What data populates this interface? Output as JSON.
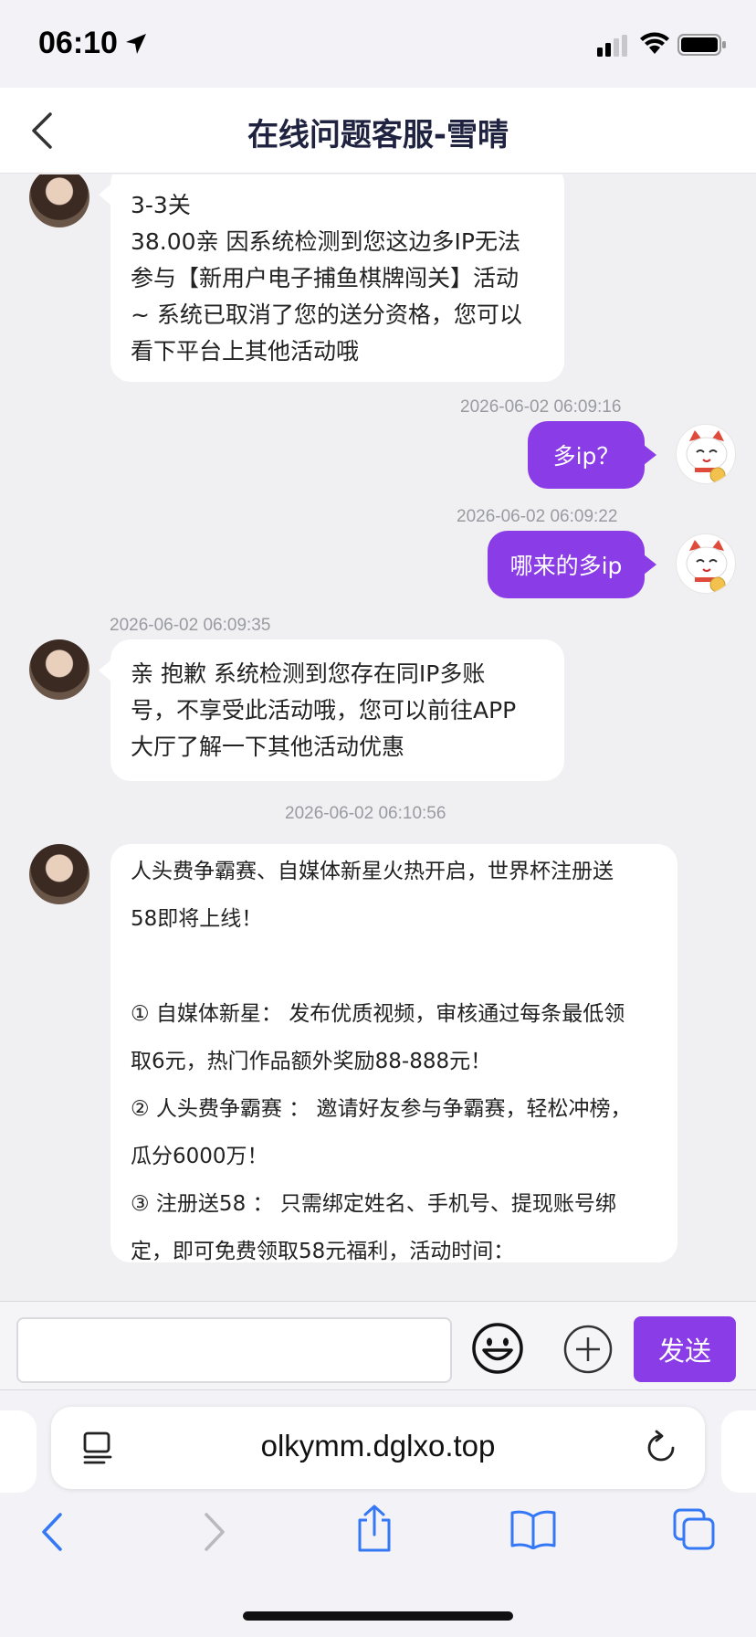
{
  "status_bar": {
    "time": "06:10"
  },
  "header": {
    "title": "在线问题客服-雪晴"
  },
  "messages": {
    "m1": {
      "lines": [
        "3-3关",
        "38.00亲 因系统检测到您这边多IP无法",
        "参与【新用户电子捕鱼棋牌闯关】活动",
        "~ 系统已取消了您的送分资格，您可以",
        "看下平台上其他活动哦"
      ]
    },
    "m2": {
      "time": "2026-06-02 06:09:16",
      "text": "多ip？"
    },
    "m3": {
      "time": "2026-06-02 06:09:22",
      "text": "哪来的多ip"
    },
    "m4": {
      "time": "2026-06-02 06:09:35",
      "lines": [
        "亲  抱歉 系统检测到您存在同IP多账",
        "号，不享受此活动哦，您可以前往APP",
        "大厅了解一下其他活动优惠"
      ]
    },
    "m5": {
      "time": "2026-06-02 06:10:56",
      "lines": [
        "人头费争霸赛、自媒体新星火热开启，世界杯注册送",
        "58即将上线！",
        "",
        "① 自媒体新星：  发布优质视频，审核通过每条最低领",
        "取6元，热门作品额外奖励88-888元！",
        "② 人头费争霸赛 ：  邀请好友参与争霸赛，轻松冲榜，",
        "瓜分6000万！",
        "③ 注册送58 ：  只需绑定姓名、手机号、提现账号绑",
        "定，即可免费领取58元福利，活动时间："
      ]
    }
  },
  "input": {
    "placeholder": "",
    "send_label": "发送"
  },
  "browser": {
    "url": "olkymm.dglxo.top"
  },
  "colors": {
    "accent": "#8a3ce6",
    "header_title": "#1f2340",
    "ios_blue": "#3478f6"
  }
}
